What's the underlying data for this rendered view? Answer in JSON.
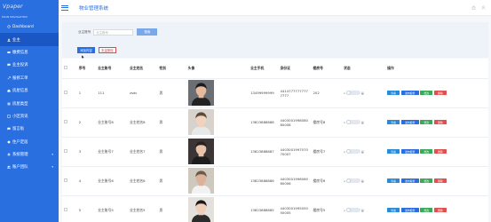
{
  "brand": {
    "logo_text": "Vpaper"
  },
  "nav": {
    "heading": "MAIN NAVIGATION",
    "items": [
      {
        "label": "Dashboard",
        "icon": "dashboard-icon"
      },
      {
        "label": "业主",
        "icon": "user-icon",
        "active": true
      },
      {
        "label": "缴费信息",
        "icon": "money-icon"
      },
      {
        "label": "业主投诉",
        "icon": "complaint-icon"
      },
      {
        "label": "报修工单",
        "icon": "repair-icon"
      },
      {
        "label": "房屋信息",
        "icon": "house-icon"
      },
      {
        "label": "房屋类型",
        "icon": "type-icon"
      },
      {
        "label": "小区资讯",
        "icon": "news-icon"
      },
      {
        "label": "留言板",
        "icon": "message-icon"
      },
      {
        "label": "住户定居",
        "icon": "resident-icon"
      },
      {
        "label": "系统管理",
        "icon": "settings-icon",
        "expandable": true
      },
      {
        "label": "账户团队",
        "icon": "team-icon",
        "expandable": true
      }
    ]
  },
  "header": {
    "title": "物业管理系统"
  },
  "filter": {
    "label": "业主账号",
    "placeholder": "业主账号",
    "search_label": "搜索",
    "add_label": "添加内容",
    "delete_label": "批量删除"
  },
  "table": {
    "columns": [
      "",
      "序号",
      "业主账号",
      "业主姓名",
      "性别",
      "头像",
      "业主手机",
      "身份证",
      "楼房号",
      "状态",
      "操作"
    ],
    "rows": [
      {
        "index": "1",
        "account": "111",
        "name": "zsdc",
        "gender": "男",
        "phone": "13499999999",
        "id_card": "44147777777777777",
        "room": "202"
      },
      {
        "index": "2",
        "account": "业主账号8",
        "name": "业主姓名8",
        "gender": "男",
        "phone": "13823888888",
        "id_card": "440300199808080008",
        "room": "楼房号8"
      },
      {
        "index": "3",
        "account": "业主账号7",
        "name": "业主姓名7",
        "gender": "男",
        "phone": "13823888887",
        "id_card": "440300199707070007",
        "room": "楼房号7"
      },
      {
        "index": "4",
        "account": "业主账号6",
        "name": "业主姓名6",
        "gender": "男",
        "phone": "13823888886",
        "id_card": "440300199606060006",
        "room": "楼房号6"
      },
      {
        "index": "5",
        "account": "业主账号5",
        "name": "业主姓名5",
        "gender": "男",
        "phone": "13823888885",
        "id_card": "440300199505050005",
        "room": "楼房号5"
      }
    ],
    "status_left": "x",
    "status_right": "是",
    "ops": {
      "view": "查看",
      "score": "发布报修",
      "edit": "修改",
      "delete": "删除"
    }
  },
  "colors": {
    "primary": "#2a6fe0",
    "sidebar": "#2a6fe0",
    "danger": "#e05050",
    "success": "#3aaa5a"
  }
}
